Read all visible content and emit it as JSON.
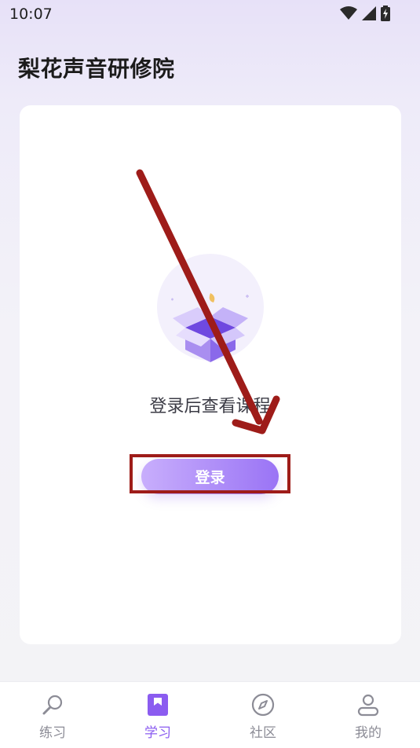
{
  "status_bar": {
    "time": "10:07",
    "icons": [
      "wifi-icon",
      "signal-icon",
      "battery-charging-icon"
    ]
  },
  "header": {
    "title": "梨花声音研修院"
  },
  "main": {
    "empty_state": {
      "illustration": "open-box-icon",
      "message": "登录后查看课程"
    },
    "login_button_label": "登录"
  },
  "tabs": [
    {
      "label": "练习",
      "icon": "microphone-icon",
      "active": false
    },
    {
      "label": "学习",
      "icon": "bookmark-book-icon",
      "active": true
    },
    {
      "label": "社区",
      "icon": "compass-icon",
      "active": false
    },
    {
      "label": "我的",
      "icon": "person-icon",
      "active": false
    }
  ],
  "colors": {
    "accent": "#8b5cf0",
    "annotation": "#9e1c19",
    "inactive_tab": "#8c8c96"
  }
}
